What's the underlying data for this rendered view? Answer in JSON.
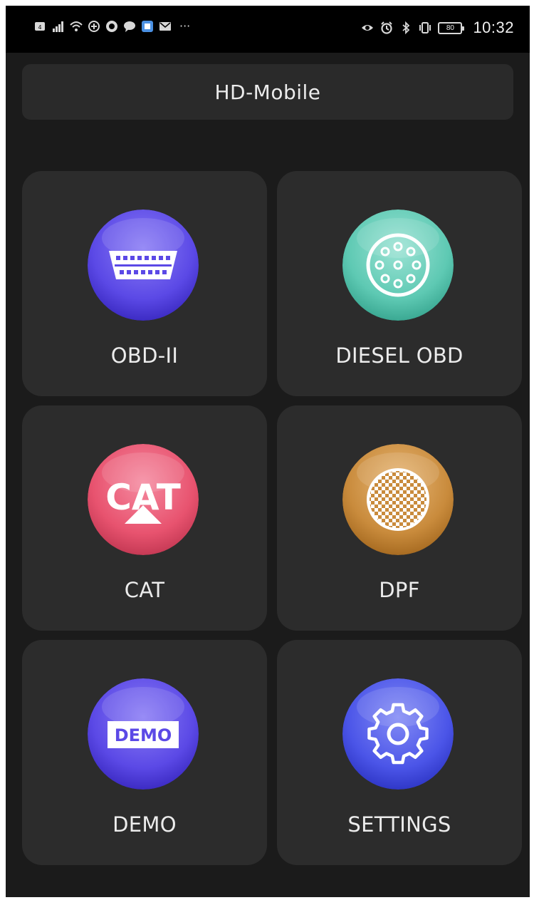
{
  "status_bar": {
    "time": "10:32",
    "battery": "80",
    "left_icons": [
      "notification-badge-icon",
      "signal-bars-icon",
      "wifi-icon",
      "data-saver-icon",
      "app-notification-icon",
      "chat-icon",
      "app-square-icon",
      "mail-icon"
    ],
    "right_icons": [
      "eye-icon",
      "alarm-icon",
      "bluetooth-icon",
      "vibrate-icon",
      "battery-icon"
    ],
    "more": "···"
  },
  "header": {
    "title": "HD-Mobile"
  },
  "tiles": [
    {
      "label": "OBD-II",
      "icon": "obd-connector-icon",
      "color": "#5b49e6"
    },
    {
      "label": "DIESEL OBD",
      "icon": "diesel-connector-icon",
      "color": "#5ec9b3"
    },
    {
      "label": "CAT",
      "icon": "cat-logo-icon",
      "color": "#e8536f",
      "icon_text": "CAT"
    },
    {
      "label": "DPF",
      "icon": "dpf-filter-icon",
      "color": "#c98b3c"
    },
    {
      "label": "DEMO",
      "icon": "demo-badge-icon",
      "color": "#5b49e6",
      "icon_text": "DEMO"
    },
    {
      "label": "SETTINGS",
      "icon": "gear-icon",
      "color": "#4b55e8"
    }
  ],
  "colors": {
    "background": "#1b1b1b",
    "tile": "#2c2c2c",
    "header": "#2a2a2a",
    "text": "#ececec"
  }
}
